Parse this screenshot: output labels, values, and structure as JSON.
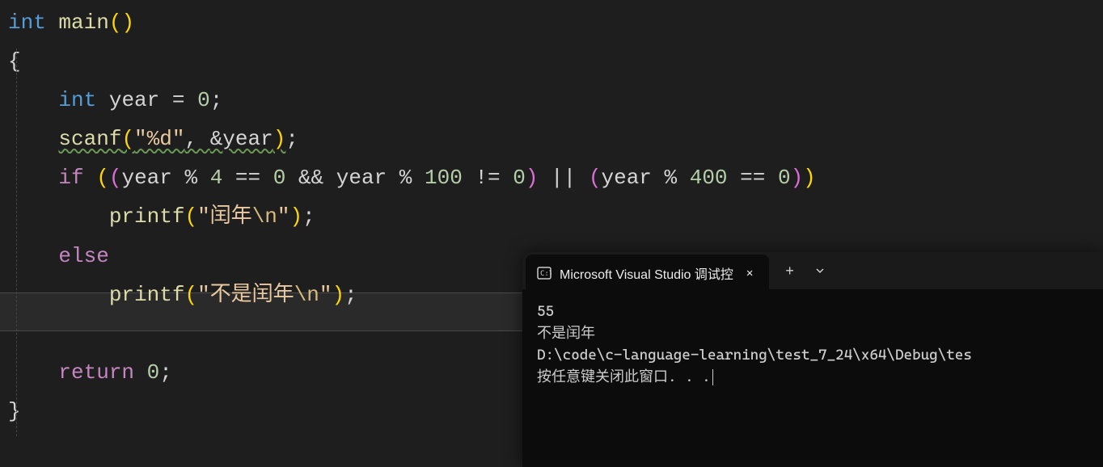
{
  "code": {
    "l1": {
      "int": "int",
      "main": "main",
      "p_open": "(",
      "p_close": ")"
    },
    "l2": {
      "brace": "{"
    },
    "l3": {
      "int": "int",
      "var": "year",
      "eq": " = ",
      "zero": "0",
      "semi": ";"
    },
    "l4": {
      "scanf": "scanf",
      "po": "(",
      "str": "\"%d\"",
      "comma": ", ",
      "amp": "&",
      "var": "year",
      "pc": ")",
      "semi": ";"
    },
    "l5": {
      "if": "if",
      "po1": "(",
      "po2": "(",
      "year1": "year",
      "mod1": " % ",
      "four": "4",
      "eq1": " == ",
      "zero1": "0",
      "and": " && ",
      "year2": "year",
      "mod2": " % ",
      "hund": "100",
      "ne": " != ",
      "zero2": "0",
      "pc2": ")",
      "or": " || ",
      "po3": "(",
      "year3": "year",
      "mod3": " % ",
      "fh": "400",
      "eq2": " == ",
      "zero3": "0",
      "pc3": ")",
      "pc1": ")"
    },
    "l6": {
      "printf": "printf",
      "po": "(",
      "q1": "\"",
      "txt": "闰年",
      "esc": "\\n",
      "q2": "\"",
      "pc": ")",
      "semi": ";"
    },
    "l7": {
      "else": "else"
    },
    "l8": {
      "printf": "printf",
      "po": "(",
      "q1": "\"",
      "txt": "不是闰年",
      "esc": "\\n",
      "q2": "\"",
      "pc": ")",
      "semi": ";"
    },
    "l10": {
      "return": "return",
      "sp": " ",
      "zero": "0",
      "semi": ";"
    },
    "l11": {
      "brace": "}"
    }
  },
  "terminal": {
    "tab_title": "Microsoft Visual Studio 调试控",
    "line1": "55",
    "line2": "不是闰年",
    "line3": "",
    "line4": "D:\\code\\c-language-learning\\test_7_24\\x64\\Debug\\tes",
    "line5": "按任意键关闭此窗口. . ."
  }
}
